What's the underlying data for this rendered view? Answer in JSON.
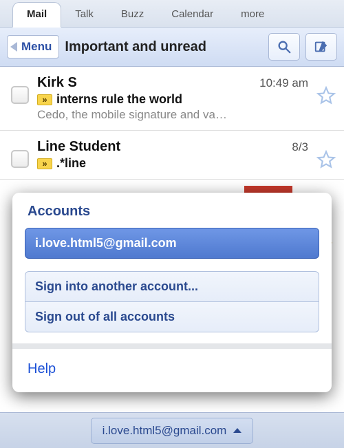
{
  "tabs": {
    "items": [
      "Mail",
      "Talk",
      "Buzz",
      "Calendar",
      "more"
    ],
    "active_index": 0
  },
  "toolbar": {
    "menu_label": "Menu",
    "title": "Important and unread"
  },
  "mails": [
    {
      "sender": "Kirk S",
      "date": "10:49 am",
      "subject": "interns rule the world",
      "snippet": "Cedo, the mobile signature and va…"
    },
    {
      "sender": "Line Student",
      "date": "8/3",
      "subject": ".*line",
      "snippet": ""
    }
  ],
  "accounts_popup": {
    "title": "Accounts",
    "selected_account": "i.love.html5@gmail.com",
    "sign_in_label": "Sign into another account...",
    "sign_out_label": "Sign out of all accounts",
    "help_label": "Help"
  },
  "footer": {
    "account": "i.love.html5@gmail.com"
  }
}
